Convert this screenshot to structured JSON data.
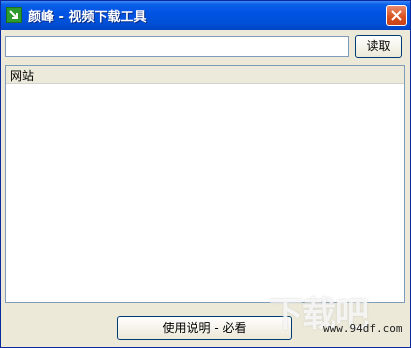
{
  "window": {
    "title": "颜峰 - 视频下载工具",
    "colors": {
      "titlebar": "#0054e3",
      "close": "#d9501d",
      "body": "#ece9d8"
    }
  },
  "toolbar": {
    "url_value": "",
    "read_label": "读取"
  },
  "list": {
    "columns": [
      "网站"
    ],
    "rows": []
  },
  "footer": {
    "help_label": "使用说明 - 必看"
  },
  "watermark": {
    "logo_text": "下载吧",
    "url": "www.94df.com"
  },
  "icons": {
    "app": "download-arrow-icon",
    "close": "close-icon"
  }
}
